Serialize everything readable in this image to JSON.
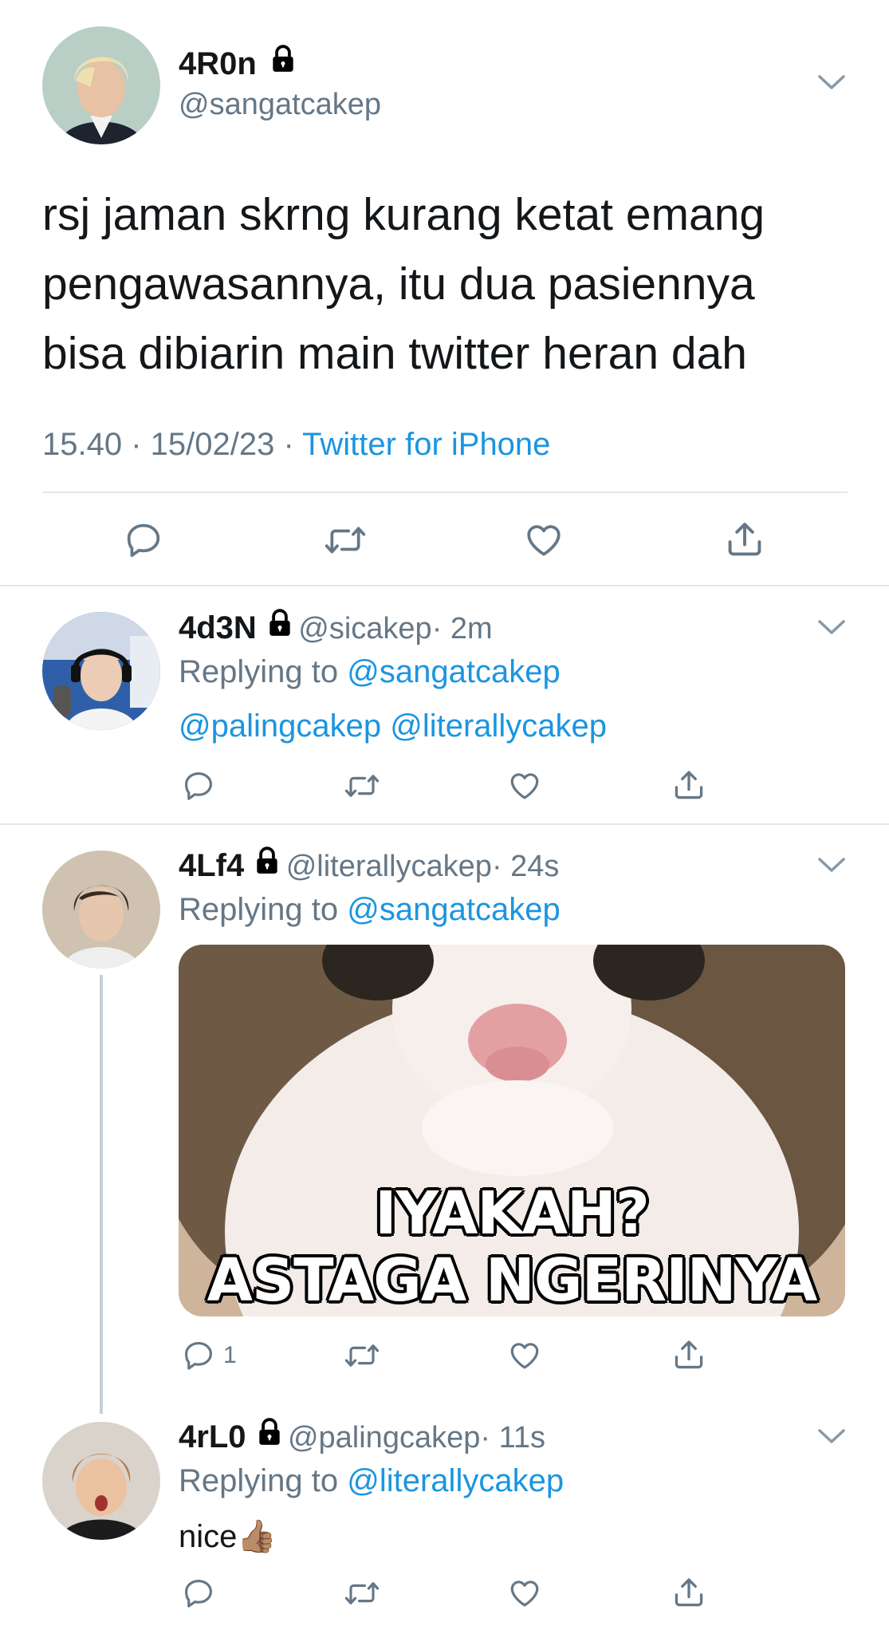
{
  "colors": {
    "link": "#1b95e0",
    "secondary": "#657786",
    "divider": "#e1e8ed",
    "text": "#14171a"
  },
  "main_tweet": {
    "display_name": "4R0n",
    "handle": "@sangatcakep",
    "text_lines": [
      "rsj jaman skrng kurang ketat emang",
      "pengawasannya, itu dua pasiennya",
      "bisa dibiarin main twitter heran dah"
    ],
    "timestamp": "15.40 · 15/02/23 ·",
    "source": "Twitter for iPhone",
    "icons": [
      "reply-icon",
      "retweet-icon",
      "like-icon",
      "share-icon"
    ]
  },
  "replies": [
    {
      "display_name": "4d3N",
      "handle": "@sicakep",
      "time": "· 2m",
      "replying_prefix": "Replying to",
      "replying_to": "@sangatcakep",
      "body_mentions": "@palingcakep @literallycakep",
      "reply_count": ""
    },
    {
      "display_name": "4Lf4",
      "handle": "@literallycakep",
      "time": "· 24s",
      "replying_prefix": "Replying to",
      "replying_to": "@sangatcakep",
      "meme_line1": "IYAKAH?",
      "meme_line2": "ASTAGA NGERINYA",
      "reply_count": "1"
    },
    {
      "display_name": "4rL0",
      "handle": "@palingcakep",
      "time": "· 11s",
      "replying_prefix": "Replying to",
      "replying_to": "@literallycakep",
      "body_text": "nice👍🏽",
      "reply_count": ""
    }
  ]
}
